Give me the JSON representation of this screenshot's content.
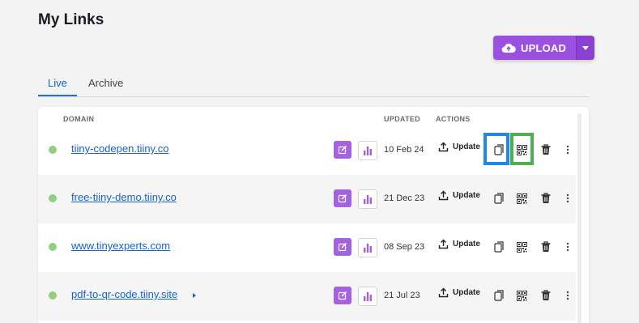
{
  "page": {
    "title": "My Links"
  },
  "upload": {
    "label": "UPLOAD",
    "icon": "cloud-upload-icon",
    "color": "#9b51e0"
  },
  "tabs": [
    {
      "label": "Live",
      "active": true
    },
    {
      "label": "Archive",
      "active": false
    }
  ],
  "columns": {
    "domain": "DOMAIN",
    "updated": "UPDATED",
    "actions": "ACTIONS"
  },
  "rows": [
    {
      "domain": "tiiny-codepen.tiiny.co",
      "updated": "10 Feb 24",
      "update_label": "Update",
      "status_color": "#93d07e",
      "expandable": false
    },
    {
      "domain": "free-tiiny-demo.tiiny.co",
      "updated": "21 Dec 23",
      "update_label": "Update",
      "status_color": "#93d07e",
      "expandable": false
    },
    {
      "domain": "www.tinyexperts.com",
      "updated": "08 Sep 23",
      "update_label": "Update",
      "status_color": "#93d07e",
      "expandable": false
    },
    {
      "domain": "pdf-to-qr-code.tiiny.site",
      "updated": "21 Jul 23",
      "update_label": "Update",
      "status_color": "#93d07e",
      "expandable": true
    }
  ],
  "highlights": {
    "copy_color": "#1e88e5",
    "qr_color": "#4caf50"
  }
}
